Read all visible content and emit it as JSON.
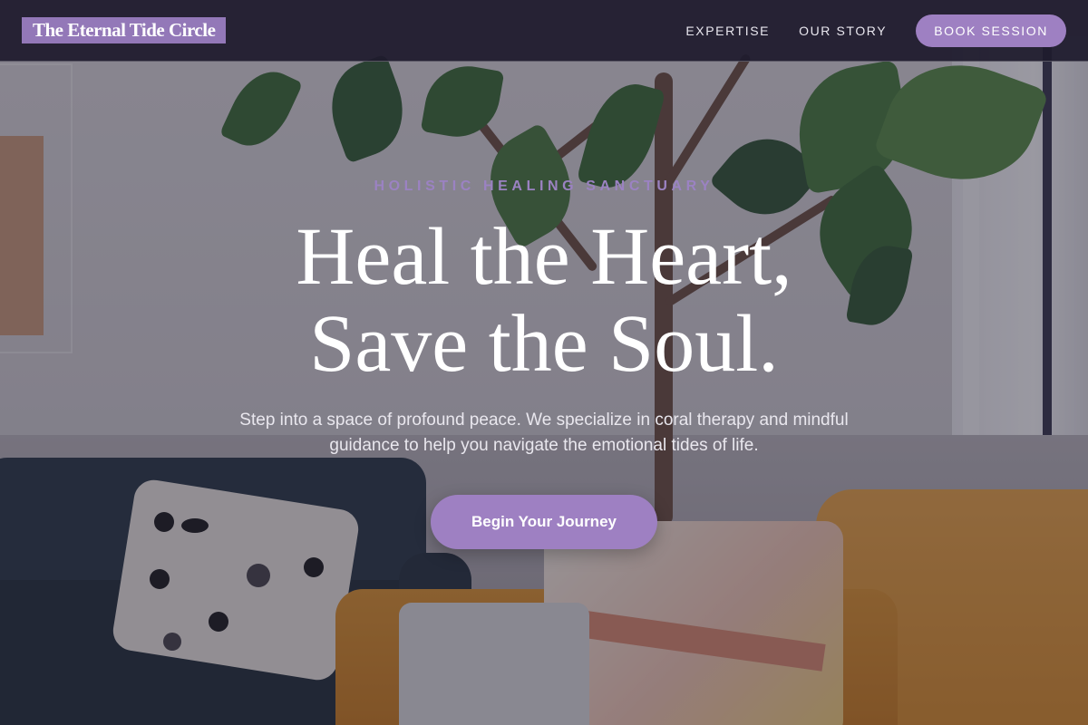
{
  "header": {
    "brand": "The Eternal Tide Circle",
    "nav": [
      {
        "label": "EXPERTISE"
      },
      {
        "label": "OUR STORY"
      }
    ],
    "cta_label": "BOOK SESSION"
  },
  "hero": {
    "eyebrow": "HOLISTIC HEALING SANCTUARY",
    "headline_line1": "Heal the Heart,",
    "headline_line2": "Save the Soul.",
    "subtext": "Step into a space of profound peace. We specialize in coral therapy and mindful guidance to help you navigate the emotional tides of life.",
    "cta_label": "Begin Your Journey"
  },
  "colors": {
    "accent": "#9e80c2",
    "eyebrow": "#9b82c2",
    "header_bg": "#1e1b2d"
  }
}
